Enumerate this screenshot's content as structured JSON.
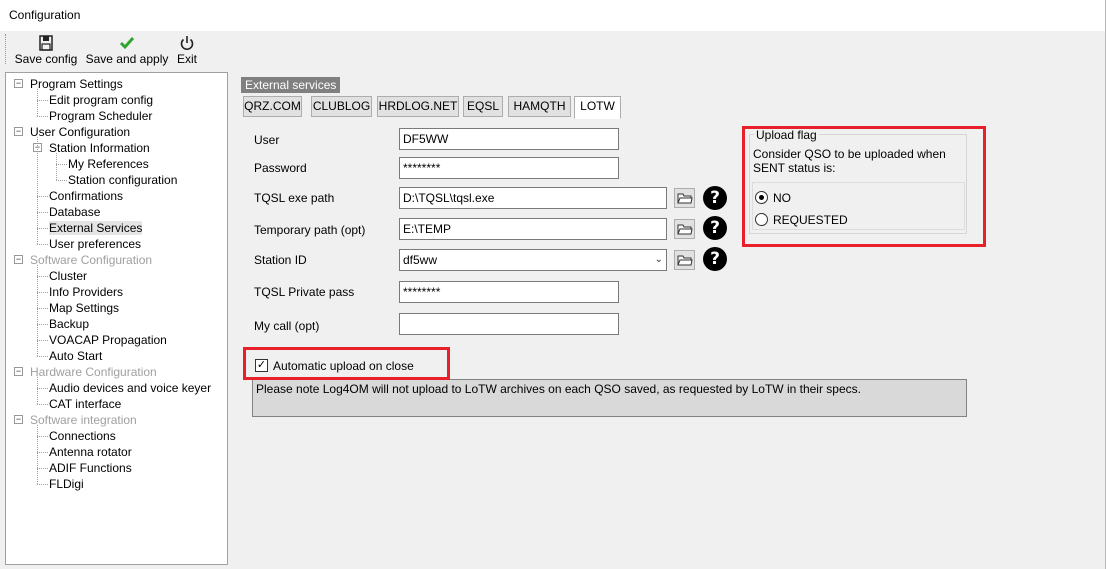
{
  "window": {
    "title": "Configuration"
  },
  "toolbar": {
    "buttons": [
      {
        "label": "Save config",
        "icon": "floppy-disk-icon"
      },
      {
        "label": "Save and apply",
        "icon": "green-check-icon"
      },
      {
        "label": "Exit",
        "icon": "power-icon"
      }
    ]
  },
  "tree": {
    "items": [
      {
        "label": "Program Settings",
        "level": 0,
        "expandable": true,
        "disabled": false
      },
      {
        "label": "Edit program config",
        "level": 1
      },
      {
        "label": "Program Scheduler",
        "level": 1
      },
      {
        "label": "User Configuration",
        "level": 0,
        "expandable": true,
        "disabled": false
      },
      {
        "label": "Station Information",
        "level": 1,
        "expandable": true
      },
      {
        "label": "My References",
        "level": 2
      },
      {
        "label": "Station configuration",
        "level": 2
      },
      {
        "label": "Confirmations",
        "level": 1
      },
      {
        "label": "Database",
        "level": 1
      },
      {
        "label": "External Services",
        "level": 1,
        "selected": true
      },
      {
        "label": "User preferences",
        "level": 1
      },
      {
        "label": "Software Configuration",
        "level": 0,
        "expandable": true,
        "disabled": true
      },
      {
        "label": "Cluster",
        "level": 1
      },
      {
        "label": "Info Providers",
        "level": 1
      },
      {
        "label": "Map Settings",
        "level": 1
      },
      {
        "label": "Backup",
        "level": 1
      },
      {
        "label": "VOACAP Propagation",
        "level": 1
      },
      {
        "label": "Auto Start",
        "level": 1
      },
      {
        "label": "Hardware Configuration",
        "level": 0,
        "expandable": true,
        "disabled": true
      },
      {
        "label": "Audio devices and voice keyer",
        "level": 1
      },
      {
        "label": "CAT interface",
        "level": 1
      },
      {
        "label": "Software integration",
        "level": 0,
        "expandable": true,
        "disabled": true
      },
      {
        "label": "Connections",
        "level": 1
      },
      {
        "label": "Antenna rotator",
        "level": 1
      },
      {
        "label": "ADIF Functions",
        "level": 1
      },
      {
        "label": "FLDigi",
        "level": 1
      }
    ]
  },
  "panel": {
    "group_label": "External services",
    "tabs": [
      "QRZ.COM",
      "CLUBLOG",
      "HRDLOG.NET",
      "EQSL",
      "HAMQTH",
      "LOTW"
    ],
    "active_tab": "LOTW"
  },
  "form": {
    "user_label": "User",
    "user_value": "DF5WW",
    "password_label": "Password",
    "password_value": "********",
    "tqsl_path_label": "TQSL exe path",
    "tqsl_path_value": "D:\\TQSL\\tqsl.exe",
    "temp_path_label": "Temporary path (opt)",
    "temp_path_value": "E:\\TEMP",
    "station_id_label": "Station ID",
    "station_id_value": "df5ww",
    "private_pass_label": "TQSL Private pass",
    "private_pass_value": "********",
    "my_call_label": "My call (opt)",
    "my_call_value": ""
  },
  "upload_flag": {
    "title": "Upload flag",
    "description": "Consider QSO to be uploaded when SENT status is:",
    "options": [
      {
        "label": "NO",
        "checked": true
      },
      {
        "label": "REQUESTED",
        "checked": false
      }
    ]
  },
  "auto_upload": {
    "label": "Automatic upload on close",
    "checked": true
  },
  "note": "Please note Log4OM will not upload to LoTW archives on each QSO saved, as requested by LoTW in their specs.",
  "colors": {
    "highlight": "#e8202a",
    "selected_item": "#e5e5e5",
    "disabled_text": "#a0a0a0"
  }
}
